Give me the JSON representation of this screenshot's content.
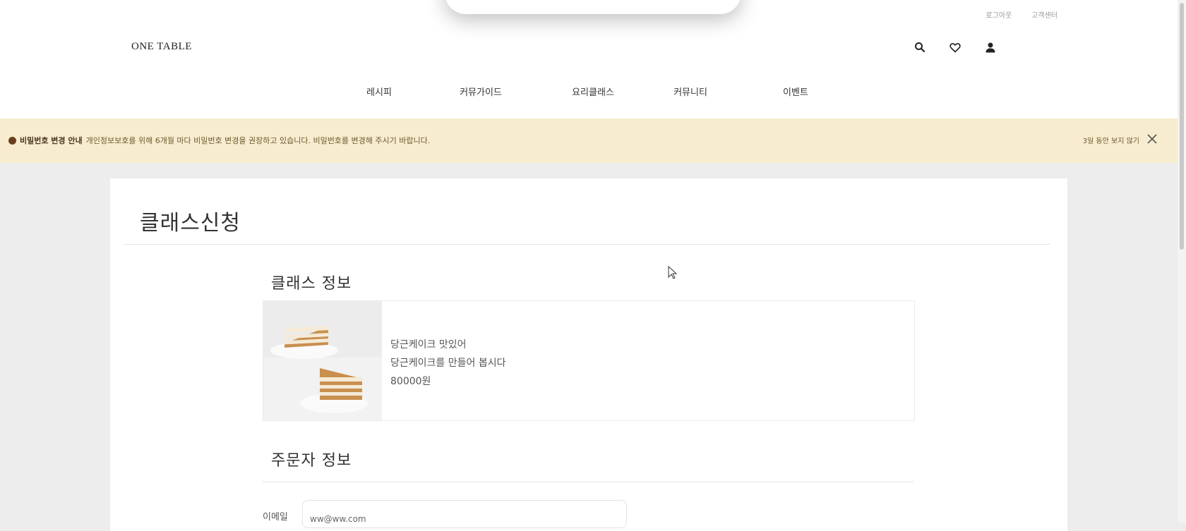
{
  "header": {
    "util_links": [
      "로그아웃",
      "고객센터"
    ],
    "logo": "ONE TABLE",
    "nav": [
      "레시피",
      "커뮤가이드",
      "요리클래스",
      "커뮤니티",
      "이벤트"
    ]
  },
  "notice": {
    "title": "비밀번호 변경 안내",
    "message": "개인정보보호를 위해 6개월 마다 비밀번호 변경을 권장하고 있습니다. 비밀번호를 변경해 주시기 바랍니다.",
    "dismiss": "3일 동안 보지 않기"
  },
  "page": {
    "title": "클래스신청"
  },
  "class_info": {
    "section_title": "클래스 정보",
    "name": "당근케이크 맛있어",
    "description": "당근케이크를 만들어 봅시다",
    "price": "80000원"
  },
  "orderer_info": {
    "section_title": "주문자 정보",
    "email_label": "이메일",
    "email_value": "ww@ww.com"
  }
}
